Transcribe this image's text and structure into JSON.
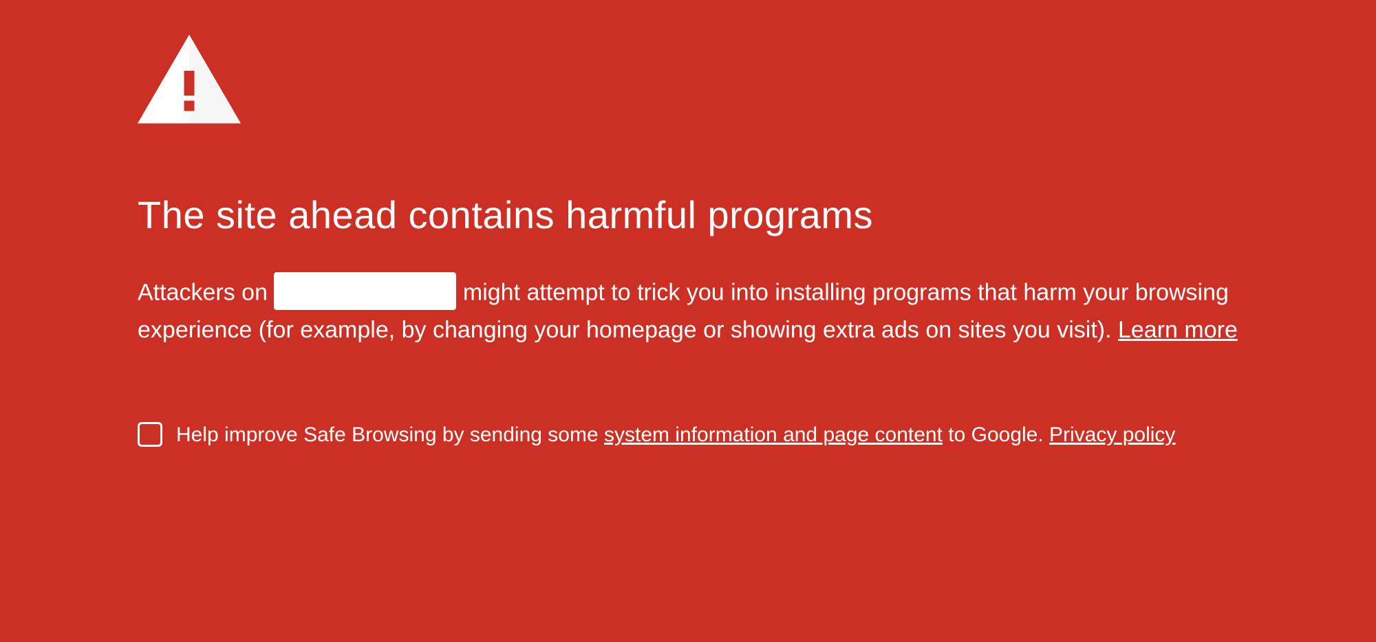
{
  "heading": "The site ahead contains harmful programs",
  "description": {
    "text_before": "Attackers on ",
    "text_after": " might attempt to trick you into installing programs that harm your browsing experience (for example, by changing your homepage or showing extra ads on sites you visit). ",
    "learn_more_label": "Learn more"
  },
  "checkbox_section": {
    "text_before": "Help improve Safe Browsing by sending some ",
    "link1_label": "system information and page content",
    "text_middle": " to Google. ",
    "link2_label": "Privacy policy"
  }
}
